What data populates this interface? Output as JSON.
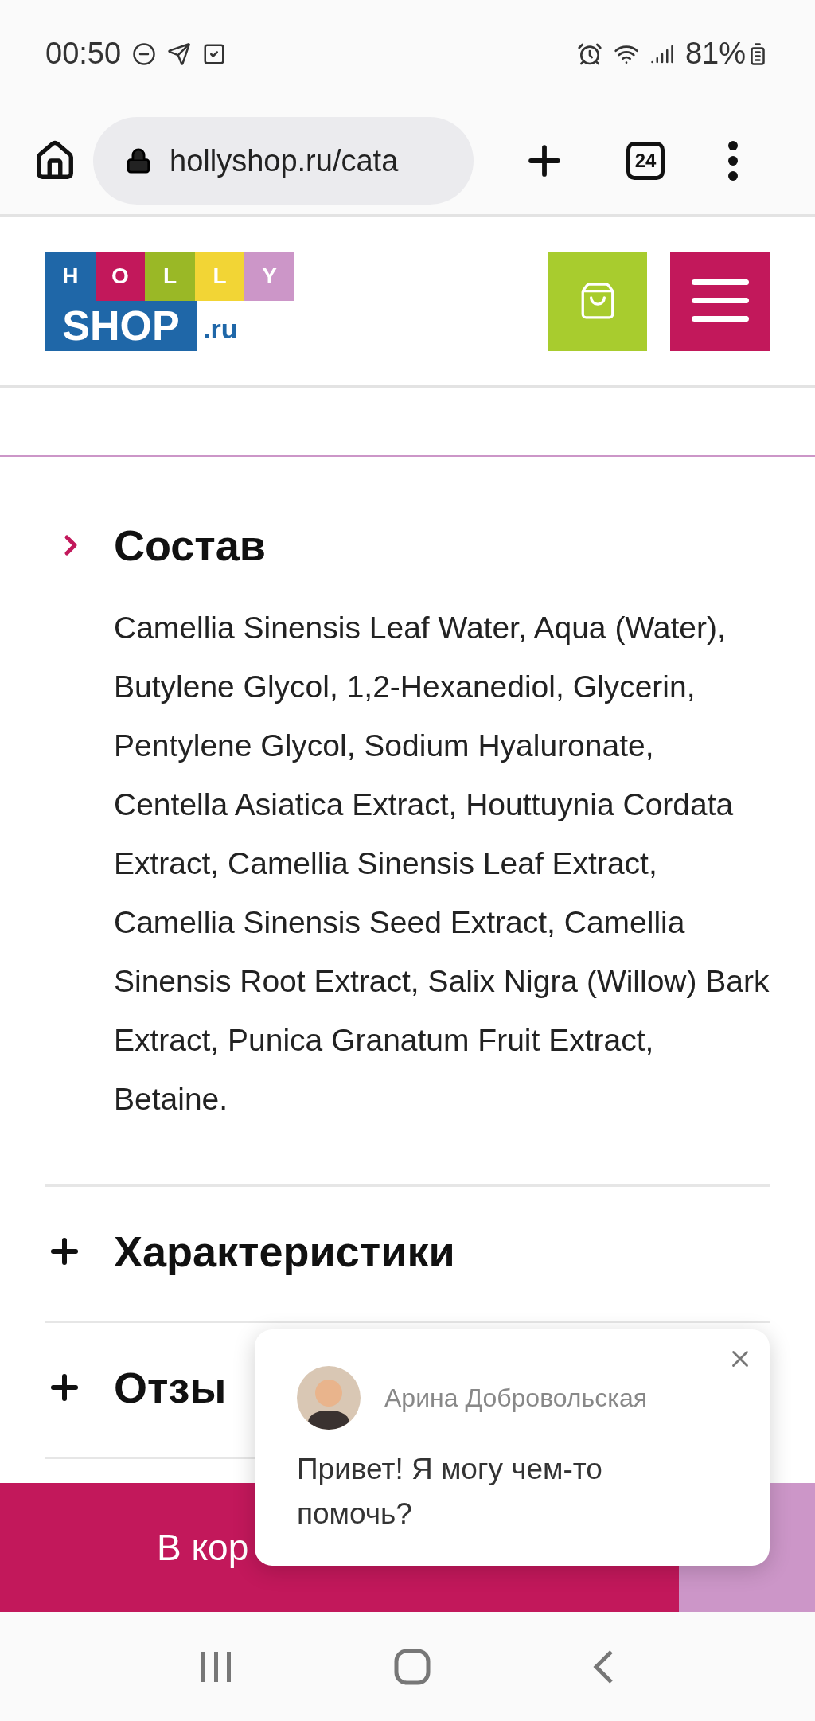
{
  "status_bar": {
    "time": "00:50",
    "battery": "81%"
  },
  "browser": {
    "url": "hollyshop.ru/cata",
    "tab_count": "24"
  },
  "logo": {
    "letters": [
      {
        "text": "H",
        "color": "#1f67a8"
      },
      {
        "text": "O",
        "color": "#c2185b"
      },
      {
        "text": "L",
        "color": "#9ab826"
      },
      {
        "text": "L",
        "color": "#f2d535"
      },
      {
        "text": "Y",
        "color": "#cc96c8"
      }
    ],
    "shop": "SHOP",
    "domain": ".ru"
  },
  "sections": [
    {
      "title": "Состав",
      "expanded": true,
      "body": "Camellia Sinensis Leaf Water, Aqua (Water), Butylene Glycol, 1,2-Hexanediol, Glycerin, Pentylene Glycol, Sodium Hyaluronate, Centella Asiatica Extract, Houttuynia Cordata Extract, Camellia Sinensis Leaf Extract, Camellia Sinensis Seed Extract, Camellia Sinensis Root Extract, Salix Nigra (Willow) Bark Extract, Punica Granatum Fruit Extract, Betaine."
    },
    {
      "title": "Характеристики",
      "expanded": false
    },
    {
      "title": "Отзы",
      "expanded": false
    }
  ],
  "cart_button": {
    "label": "В кор"
  },
  "chat_popup": {
    "name": "Арина Добровольская",
    "message": "Привет! Я могу чем-то помочь?"
  }
}
